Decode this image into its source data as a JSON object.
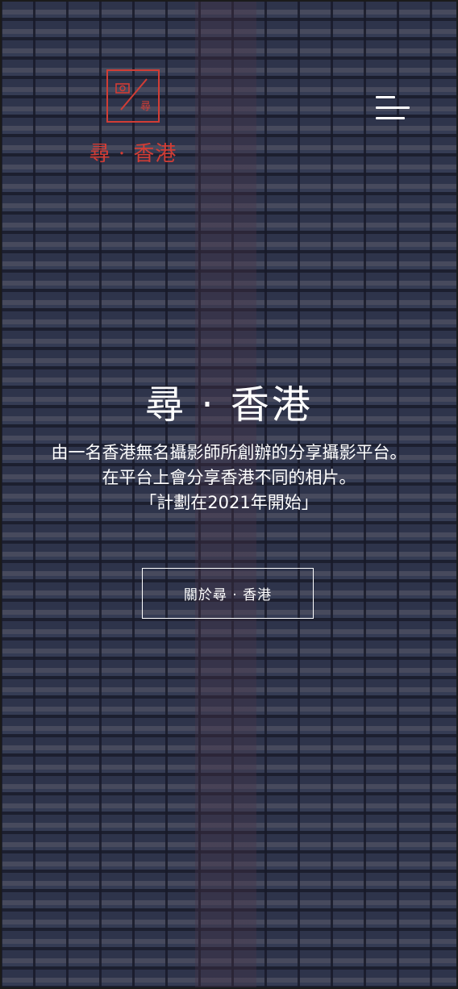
{
  "brand": {
    "logo_text": "尋 · 香港",
    "logo_mark_glyph": "尋",
    "accent_color": "#d23d35"
  },
  "nav": {
    "menu_icon": "hamburger-menu-icon"
  },
  "hero": {
    "title": "尋 · 香港",
    "description_lines": [
      "由一名香港無名攝影師所創辦的分享攝影平台。",
      "在平台上會分享香港不同的相片。",
      "「計劃在2021年開始」"
    ],
    "about_button_label": "關於尋 · 香港"
  }
}
